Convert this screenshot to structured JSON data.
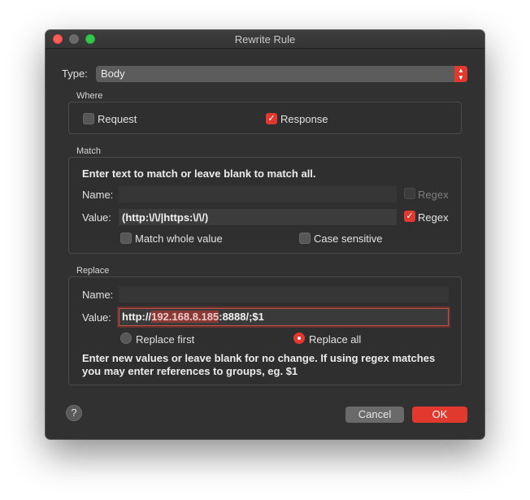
{
  "window": {
    "title": "Rewrite Rule"
  },
  "type": {
    "label": "Type:",
    "value": "Body"
  },
  "where": {
    "title": "Where",
    "request_label": "Request",
    "request_checked": false,
    "response_label": "Response",
    "response_checked": true
  },
  "match": {
    "title": "Match",
    "instruction": "Enter text to match or leave blank to match all.",
    "name_label": "Name:",
    "name_value": "",
    "name_regex_label": "Regex",
    "value_label": "Value:",
    "value_value": "(http:\\/\\/|https:\\/\\/)",
    "value_regex_label": "Regex",
    "match_whole_label": "Match whole value",
    "case_sensitive_label": "Case sensitive"
  },
  "replace": {
    "title": "Replace",
    "name_label": "Name:",
    "name_value": "",
    "value_label": "Value:",
    "value_prefix": "http://",
    "value_selected": "192.168.8.185",
    "value_suffix": ":8888/;$1",
    "replace_first_label": "Replace first",
    "replace_all_label": "Replace all",
    "selected_mode": "Replace all",
    "help_text": "Enter new values or leave blank for no change. If using regex matches you may enter references to groups, eg. $1"
  },
  "buttons": {
    "help": "?",
    "cancel": "Cancel",
    "ok": "OK"
  },
  "colors": {
    "accent": "#e2392f",
    "window_bg": "#313131"
  }
}
